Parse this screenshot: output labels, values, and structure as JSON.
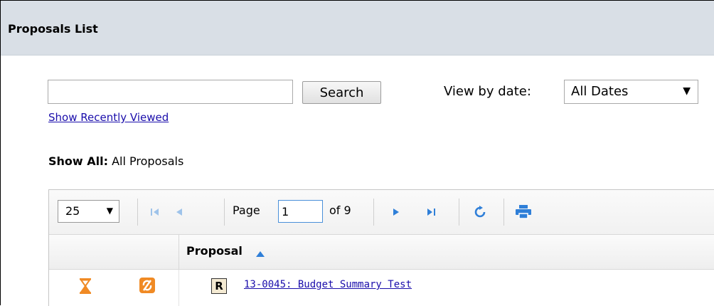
{
  "header": {
    "title": "Proposals List"
  },
  "search": {
    "value": "",
    "placeholder": "",
    "button_label": "Search"
  },
  "recent_link": "Show Recently Viewed",
  "view_by": {
    "label": "View by date:",
    "selected": "All Dates"
  },
  "show_all": {
    "label": "Show All:",
    "value": "All Proposals"
  },
  "pager": {
    "page_size": "25",
    "page_label": "Page",
    "current_page": "1",
    "of_label": "of 9"
  },
  "table": {
    "columns": [
      "Proposal"
    ],
    "rows": [
      {
        "badge": "R",
        "proposal": "13-0045: Budget Summary Test"
      }
    ]
  },
  "colors": {
    "accent": "#2f7fd8",
    "status_orange": "#f08a24",
    "link": "#1a0dab",
    "header_bg": "#d9dfe6"
  },
  "icons": [
    "first-page-icon",
    "prev-page-icon",
    "next-page-icon",
    "last-page-icon",
    "refresh-icon",
    "print-icon",
    "hourglass-icon",
    "no-sync-icon",
    "sort-ascending-icon",
    "dropdown-arrow-icon"
  ]
}
